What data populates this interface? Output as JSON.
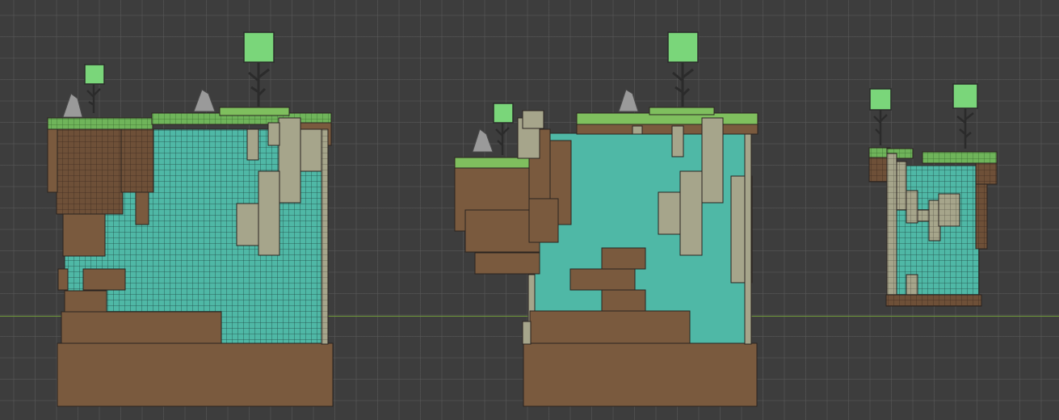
{
  "viewport": {
    "name": "scene-viewport",
    "background": "#3d3d3d",
    "grid_color": "#5a5a5a",
    "horizon_color": "#6f9a3a"
  },
  "palette": {
    "dirt": "#7a5a3e",
    "dirt_dark": "#6b4d34",
    "grass": "#7fbf5e",
    "grass_dark": "#5e9e48",
    "water": "#4fb8a6",
    "stone": "#a6a58b",
    "rock": "#9a9a9a",
    "leaf": "#7ad67a",
    "trunk": "#2b2b2b"
  },
  "islands": [
    {
      "name": "island-left",
      "tiled": true
    },
    {
      "name": "island-middle",
      "tiled": false
    },
    {
      "name": "island-right",
      "tiled": true
    }
  ]
}
